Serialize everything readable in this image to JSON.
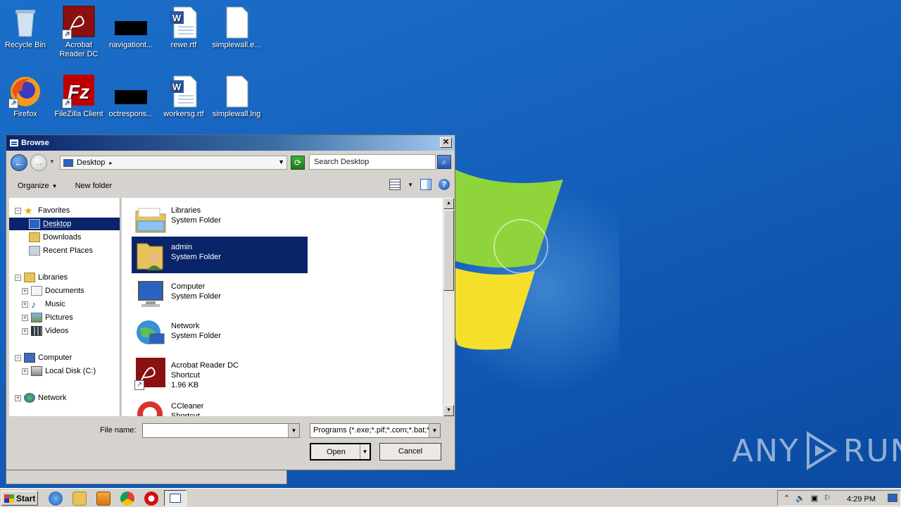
{
  "desktop": {
    "icons": [
      {
        "label": "Recycle Bin"
      },
      {
        "label": "Acrobat Reader DC"
      },
      {
        "label": "navigationt..."
      },
      {
        "label": "rewe.rtf"
      },
      {
        "label": "simplewall.e..."
      },
      {
        "label": "Firefox"
      },
      {
        "label": "FileZilla Client"
      },
      {
        "label": "octrespons..."
      },
      {
        "label": "workersg.rtf"
      },
      {
        "label": "simplewall.lng"
      }
    ]
  },
  "dialog": {
    "title": "Browse",
    "close_label": "✕",
    "address": "Desktop",
    "search_placeholder": "Search Desktop",
    "toolbar": {
      "organize": "Organize",
      "new_folder": "New folder"
    },
    "nav": {
      "favorites": "Favorites",
      "desktop": "Desktop",
      "downloads": "Downloads",
      "recent": "Recent Places",
      "libraries": "Libraries",
      "documents": "Documents",
      "music": "Music",
      "pictures": "Pictures",
      "videos": "Videos",
      "computer": "Computer",
      "localdisk": "Local Disk (C:)",
      "network": "Network"
    },
    "files": [
      {
        "name": "Libraries",
        "type": "System Folder"
      },
      {
        "name": "admin",
        "type": "System Folder"
      },
      {
        "name": "Computer",
        "type": "System Folder"
      },
      {
        "name": "Network",
        "type": "System Folder"
      },
      {
        "name": "Acrobat Reader DC",
        "type": "Shortcut",
        "size": "1.96 KB"
      },
      {
        "name": "CCleaner",
        "type": "Shortcut"
      }
    ],
    "file_name_label": "File name:",
    "file_name_value": "",
    "file_type": "Programs (*.exe;*.pif;*.com;*.bat;*.cmd)",
    "open_label": "Open",
    "cancel_label": "Cancel"
  },
  "taskbar": {
    "start_label": "Start",
    "clock": "4:29 PM"
  },
  "watermark": {
    "left": "ANY",
    "right": "RUN"
  },
  "colors": {
    "selection": "#0a246a",
    "desktop": "#1663c0",
    "chrome": "#d6d3ce"
  }
}
